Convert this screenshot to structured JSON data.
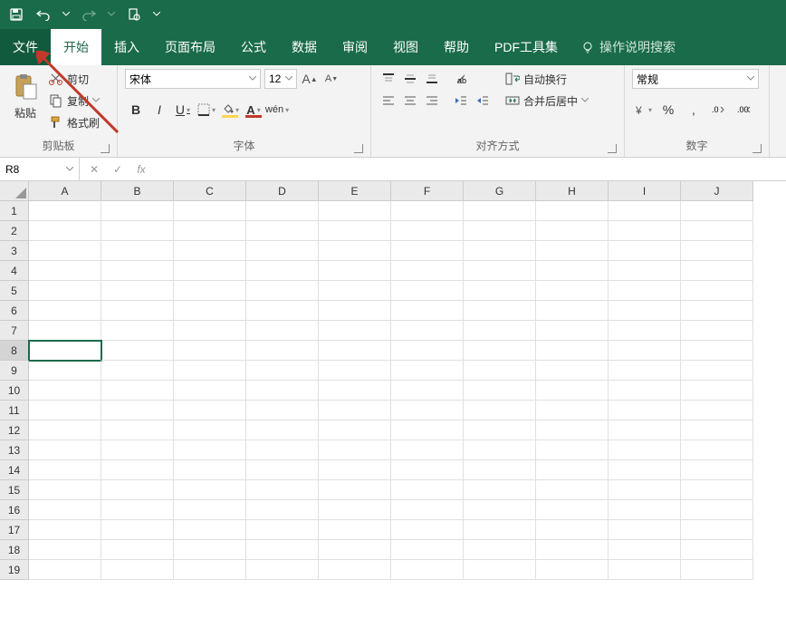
{
  "titlebar": {
    "save_icon": "save",
    "undo_icon": "undo",
    "redo_icon": "redo",
    "preview_icon": "preview"
  },
  "tabs": {
    "file": "文件",
    "home": "开始",
    "insert": "插入",
    "page_layout": "页面布局",
    "formulas": "公式",
    "data": "数据",
    "review": "审阅",
    "view": "视图",
    "help": "帮助",
    "pdf": "PDF工具集",
    "tell_me": "操作说明搜索"
  },
  "clipboard": {
    "paste": "粘贴",
    "cut": "剪切",
    "copy": "复制",
    "format_painter": "格式刷",
    "group": "剪贴板"
  },
  "font": {
    "name": "宋体",
    "size": "12",
    "bold": "B",
    "italic": "I",
    "underline": "U",
    "group": "字体"
  },
  "alignment": {
    "wrap": "自动换行",
    "merge": "合并后居中",
    "group": "对齐方式"
  },
  "number": {
    "format": "常规",
    "group": "数字"
  },
  "sheet": {
    "active_cell": "R8",
    "columns": [
      "A",
      "B",
      "C",
      "D",
      "E",
      "F",
      "G",
      "H",
      "I",
      "J"
    ],
    "rows": [
      1,
      2,
      3,
      4,
      5,
      6,
      7,
      8,
      9,
      10,
      11,
      12,
      13,
      14,
      15,
      16,
      17,
      18,
      19
    ],
    "selected_row": 8,
    "selected_col": 0
  }
}
